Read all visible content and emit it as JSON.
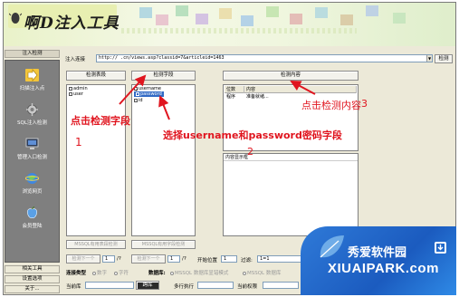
{
  "app": {
    "title": "啊D注入工具"
  },
  "sidebar": {
    "header": "注入检测",
    "items": [
      {
        "label": "扫描注入点",
        "icon": "arrow-right-icon"
      },
      {
        "label": "SQL注入检测",
        "icon": "gear-icon"
      },
      {
        "label": "管理入口检测",
        "icon": "monitor-icon"
      },
      {
        "label": "浏览网页",
        "icon": "globe-icon"
      },
      {
        "label": "会员登陆",
        "icon": "apple-icon"
      }
    ],
    "footer": [
      "相关工具",
      "设置选项",
      "关于..."
    ]
  },
  "toolbar": {
    "url_label": "注入连接",
    "url_value": "http://             .cn/views.asp?classid=7&articleid=1463",
    "detect_label": "检测"
  },
  "panels": {
    "tables_button": "检测表段",
    "fields_button": "检测字段",
    "content_button": "检测内容",
    "tables": [
      "admin",
      "user"
    ],
    "fields": [
      {
        "name": "username",
        "checked": true,
        "selected": false
      },
      {
        "name": "password",
        "checked": true,
        "selected": true
      },
      {
        "name": "id",
        "checked": false,
        "selected": false
      }
    ],
    "content_headers": [
      "位数",
      "内容"
    ],
    "content_row": [
      "程序",
      "准备就绪..."
    ],
    "content_display_label": "内容显示框",
    "mssql_table_btn": "MSSQL有用表段检测",
    "mssql_field_btn": "MSSQL有用字段检测"
  },
  "pager": {
    "prev1": "检测下一个",
    "val1": "1",
    "suffix1": "/?",
    "prev2": "检测下一个",
    "val2": "1",
    "suffix2": "/?",
    "start_label": "开始位置",
    "start_value": "1",
    "filter_label": "过滤:",
    "filter_value": "1=1"
  },
  "bottom": {
    "conn_label": "连接类型",
    "conn_opts": [
      "数字",
      "字符"
    ],
    "db_label": "数据库:",
    "db_opts": [
      "MSSQL 数据库显错模式",
      "MSSQL 数据库"
    ],
    "curdb_label": "当前库",
    "grab_button": "跨库",
    "multiline_label": "多行执行",
    "perm_label": "当前权限",
    "current_label": "当前"
  },
  "annotations": {
    "a1": "点击检测字段",
    "a1_num": "1",
    "a2": "选择username和password密码字段",
    "a2_num": "2",
    "a3": "点击检测内容",
    "a3_num": "3"
  },
  "watermark": {
    "line1": "秀爱软件园",
    "line2": "XIUAIPARK.com"
  },
  "colors": {
    "annotation": "#e0151f",
    "selection": "#316ac5",
    "watermark": "#1b5bbf"
  }
}
